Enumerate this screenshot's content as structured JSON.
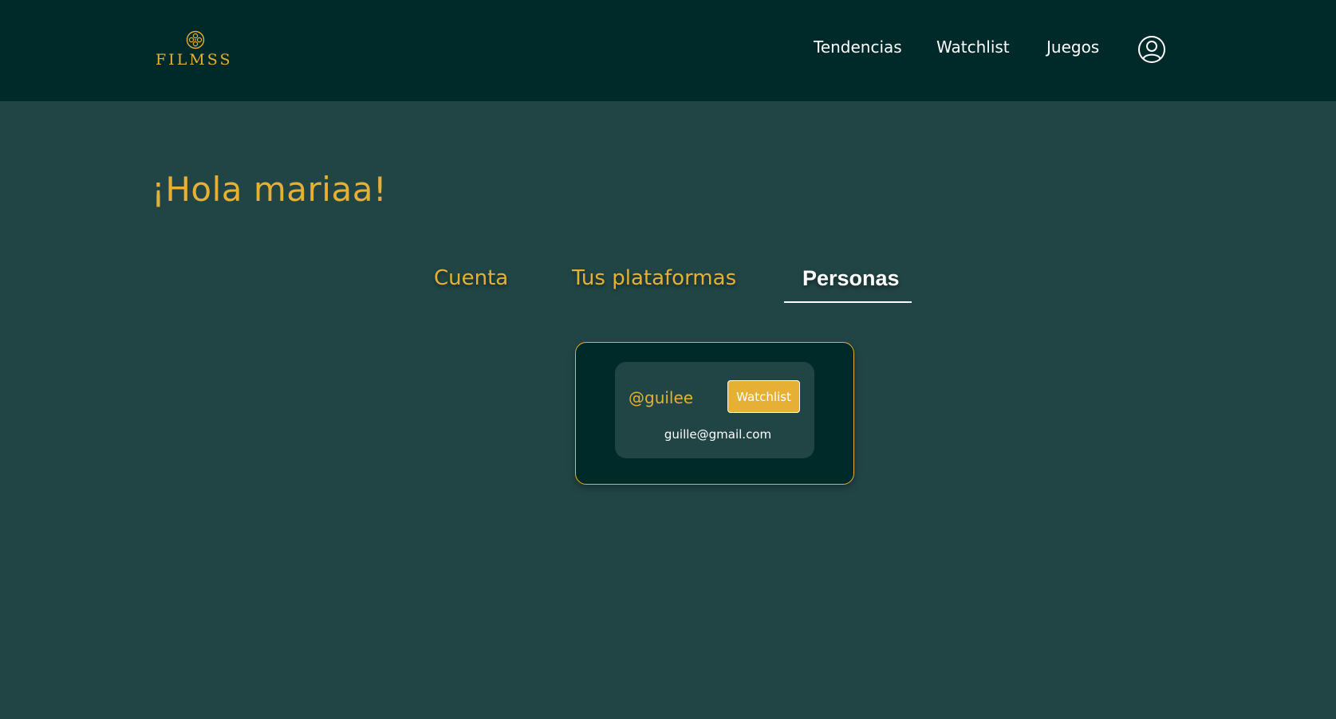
{
  "brand": {
    "name": "FILMSS",
    "icon": "film-reel-icon"
  },
  "nav": {
    "links": [
      "Tendencias",
      "Watchlist",
      "Juegos"
    ],
    "profile_icon": "user-circle-icon"
  },
  "greeting": "¡Hola mariaa!",
  "tabs": [
    {
      "label": "Cuenta",
      "active": false
    },
    {
      "label": "Tus plataformas",
      "active": false
    },
    {
      "label": "Personas",
      "active": true
    }
  ],
  "people": [
    {
      "username": "@guilee",
      "email": "guille@gmail.com",
      "button_label": "Watchlist"
    }
  ],
  "colors": {
    "header_bg": "#002a2a",
    "page_bg": "#214545",
    "accent": "#e6b034",
    "text": "#ffffff"
  }
}
